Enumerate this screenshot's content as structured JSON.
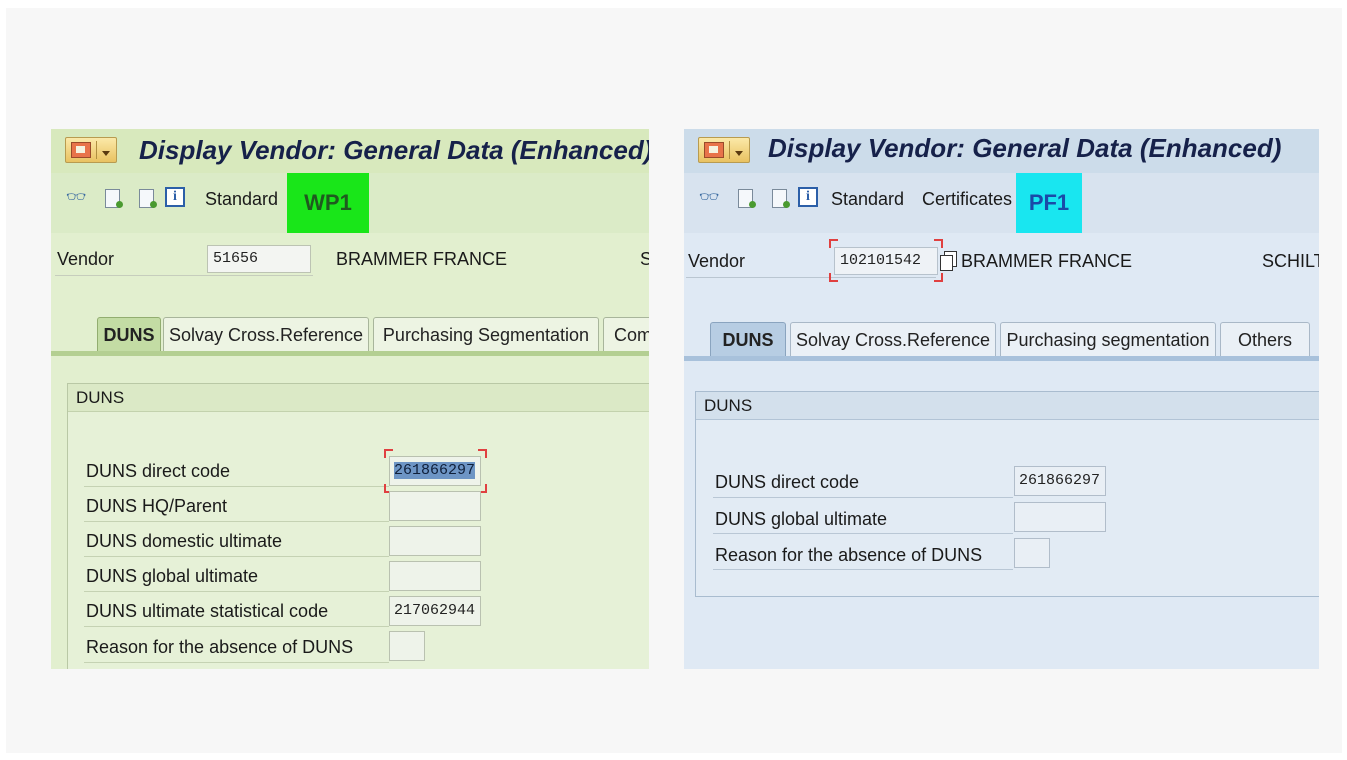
{
  "left_panel": {
    "window_title": "Display Vendor: General Data (Enhanced)",
    "toolbar": {
      "standard_label": "Standard",
      "environment_badge": "WP1",
      "badge_color": "#19e619"
    },
    "vendor": {
      "label": "Vendor",
      "number": "51656",
      "name": "BRAMMER FRANCE",
      "extra": "S"
    },
    "tabs": [
      {
        "label": "DUNS",
        "active": true
      },
      {
        "label": "Solvay Cross.Reference",
        "active": false
      },
      {
        "label": "Purchasing Segmentation",
        "active": false
      },
      {
        "label": "Com",
        "active": false
      }
    ],
    "group": {
      "title": "DUNS",
      "rows": [
        {
          "label": "DUNS direct code",
          "value": "261866297"
        },
        {
          "label": "DUNS HQ/Parent",
          "value": ""
        },
        {
          "label": "DUNS domestic ultimate",
          "value": ""
        },
        {
          "label": "DUNS global ultimate",
          "value": ""
        },
        {
          "label": "DUNS ultimate statistical code",
          "value": "217062944"
        },
        {
          "label": "Reason for the absence of DUNS",
          "value": ""
        }
      ]
    }
  },
  "right_panel": {
    "window_title": "Display Vendor: General Data (Enhanced)",
    "toolbar": {
      "standard_label": "Standard",
      "certificates_label": "Certificates",
      "environment_badge": "PF1",
      "badge_color": "#19e6f0"
    },
    "vendor": {
      "label": "Vendor",
      "number": "102101542",
      "name": "BRAMMER FRANCE",
      "extra": "SCHILTI"
    },
    "tabs": [
      {
        "label": "DUNS",
        "active": true
      },
      {
        "label": "Solvay Cross.Reference",
        "active": false
      },
      {
        "label": "Purchasing segmentation",
        "active": false
      },
      {
        "label": "Others",
        "active": false
      }
    ],
    "group": {
      "title": "DUNS",
      "rows": [
        {
          "label": "DUNS direct code",
          "value": "261866297"
        },
        {
          "label": "DUNS global ultimate",
          "value": ""
        },
        {
          "label": "Reason for the absence of DUNS",
          "value": ""
        }
      ]
    }
  },
  "icons": [
    "menu-icon",
    "glasses-icon",
    "document-icon",
    "document-export-icon",
    "info-icon",
    "copy-icon"
  ]
}
